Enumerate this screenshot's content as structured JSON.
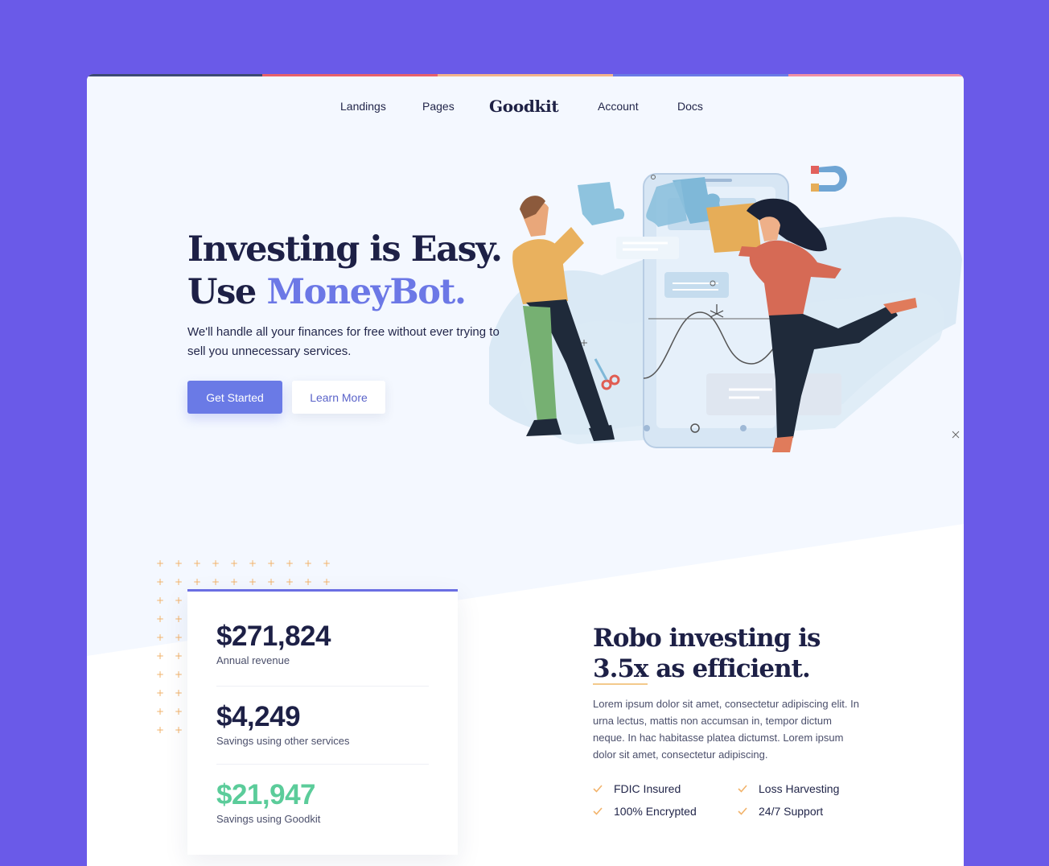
{
  "theme": {
    "page_bg": "#6a5ae8",
    "hero_bg": "#f4f8ff",
    "accent": "#6c78e6",
    "primary_button": "#6a7ae6",
    "success": "#5bcc9a",
    "topbar_colors": [
      "#3c4a73",
      "#e8606a",
      "#f2b38b",
      "#6a7ae6",
      "#f08fa4"
    ]
  },
  "nav": {
    "logo": "Goodkit",
    "items": [
      "Landings",
      "Pages",
      "Account",
      "Docs"
    ]
  },
  "hero": {
    "title_line1": "Investing is Easy.",
    "title_line2_prefix": "Use ",
    "title_line2_accent": "MoneyBot.",
    "subtitle": "We'll handle all your finances for free without ever trying to sell you unnecessary services.",
    "primary_cta": "Get Started",
    "secondary_cta": "Learn More"
  },
  "stats": [
    {
      "value": "$271,824",
      "label": "Annual revenue",
      "highlight": false
    },
    {
      "value": "$4,249",
      "label": "Savings using other services",
      "highlight": false
    },
    {
      "value": "$21,947",
      "label": "Savings using Goodkit",
      "highlight": true
    }
  ],
  "robo": {
    "title_line1": "Robo investing is",
    "title_line2_underlined": "3.5x",
    "title_line2_rest": " as efficient.",
    "body": "Lorem ipsum dolor sit amet, consectetur adipiscing elit. In urna lectus, mattis non accumsan in, tempor dictum neque. In hac habitasse platea dictumst. Lorem ipsum dolor sit amet, consectetur adipiscing.",
    "features": [
      "FDIC Insured",
      "Loss Harvesting",
      "100% Encrypted",
      "24/7 Support"
    ]
  }
}
